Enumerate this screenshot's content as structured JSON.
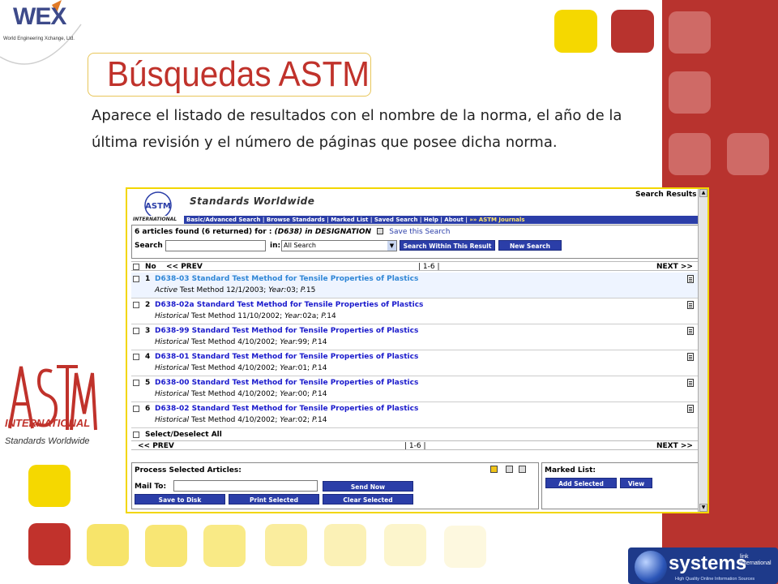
{
  "slide": {
    "title": "Búsquedas ASTM",
    "description": "Aparece el listado de resultados con el nombre de la norma, el año de la última revisión y el número de páginas que posee dicha norma.",
    "colors": {
      "red": "#b8332e",
      "yellow": "#f5d800",
      "title_red": "#c0322b"
    }
  },
  "wex_logo": {
    "name": "WEX",
    "tagline": "World Engineering Xchange, Ltd."
  },
  "astm_logo": {
    "letters": "ASTM",
    "international": "INTERNATIONAL",
    "tagline": "Standards Worldwide"
  },
  "screenshot": {
    "header": {
      "logo_letters": "ASTM",
      "logo_badge": "INTERNATIONAL",
      "brand": "Standards Worldwide",
      "page_label": "Search Results"
    },
    "nav": {
      "links": "Basic/Advanced Search | Browse Standards | Marked List | Saved Search | Help | About |",
      "highlight": "»» ASTM Journals"
    },
    "search": {
      "found_prefix": "6 articles found (6 returned) for :",
      "found_query": "(D638) in DESIGNATION",
      "save_link": "Save this Search",
      "search_label": "Search",
      "search_value": "",
      "in_label": "in:",
      "in_select": "All Search",
      "within_button": "Search Within This Result",
      "new_button": "New Search"
    },
    "pager": {
      "no_label": "No",
      "prev": "<< PREV",
      "range": "| 1-6 |",
      "next": "NEXT >>"
    },
    "results": [
      {
        "num": "1",
        "title": "D638-03 Standard Test Method for Tensile Properties of Plastics",
        "status": "Active",
        "meta_a": "Test Method 12/1/2003;",
        "year_label": "Year:",
        "year": "03;",
        "pages_label": "P.",
        "pages": "15"
      },
      {
        "num": "2",
        "title": "D638-02a Standard Test Method for Tensile Properties of Plastics",
        "status": "Historical",
        "meta_a": "Test Method 11/10/2002;",
        "year_label": "Year:",
        "year": "02a;",
        "pages_label": "P.",
        "pages": "14"
      },
      {
        "num": "3",
        "title": "D638-99 Standard Test Method for Tensile Properties of Plastics",
        "status": "Historical",
        "meta_a": "Test Method 4/10/2002;",
        "year_label": "Year:",
        "year": "99;",
        "pages_label": "P.",
        "pages": "14"
      },
      {
        "num": "4",
        "title": "D638-01 Standard Test Method for Tensile Properties of Plastics",
        "status": "Historical",
        "meta_a": "Test Method 4/10/2002;",
        "year_label": "Year:",
        "year": "01;",
        "pages_label": "P.",
        "pages": "14"
      },
      {
        "num": "5",
        "title": "D638-00 Standard Test Method for Tensile Properties of Plastics",
        "status": "Historical",
        "meta_a": "Test Method 4/10/2002;",
        "year_label": "Year:",
        "year": "00;",
        "pages_label": "P.",
        "pages": "14"
      },
      {
        "num": "6",
        "title": "D638-02 Standard Test Method for Tensile Properties of Plastics",
        "status": "Historical",
        "meta_a": "Test Method 4/10/2002;",
        "year_label": "Year:",
        "year": "02;",
        "pages_label": "P.",
        "pages": "14"
      }
    ],
    "select_all": "Select/Deselect All",
    "process": {
      "heading": "Process Selected Articles:",
      "mail_label": "Mail To:",
      "mail_value": "",
      "send": "Send Now",
      "save_disk": "Save to Disk",
      "print_selected": "Print Selected",
      "clear_selected": "Clear Selected"
    },
    "marked_list": {
      "heading": "Marked List:",
      "add": "Add Selected",
      "view": "View"
    }
  },
  "systems_link": {
    "name": "systems",
    "sub1": "link",
    "sub2": "International",
    "tagline": "High Quality Online Information Sources"
  }
}
